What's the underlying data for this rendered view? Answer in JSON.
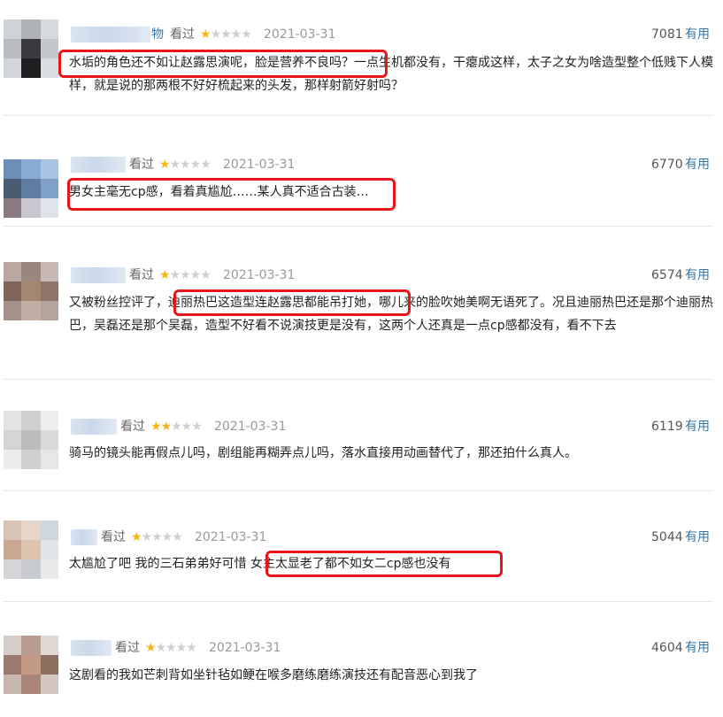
{
  "reviews": [
    {
      "name_suffix": "物",
      "seen": "看过",
      "rating": 1,
      "date": "2021-03-31",
      "votes": "7081",
      "useful": "有用",
      "content": "水垢的角色还不如让赵露思演呢，脸是营养不良吗？一点生机都没有，干瘪成这样，太子之女为啥造型整个低贱下人模样，就是说的那两根不好好梳起来的头发，那样射箭好射吗？"
    },
    {
      "name_suffix": "",
      "seen": "看过",
      "rating": 1,
      "date": "2021-03-31",
      "votes": "6770",
      "useful": "有用",
      "content": "男女主毫无cp感，看着真尴尬……某人真不适合古装…"
    },
    {
      "name_suffix": "",
      "seen": "看过",
      "rating": 1,
      "date": "2021-03-31",
      "votes": "6574",
      "useful": "有用",
      "content": "又被粉丝控评了，迪丽热巴这造型连赵露思都能吊打她，哪儿来的脸吹她美啊无语死了。况且迪丽热巴还是那个迪丽热巴，吴磊还是那个吴磊，造型不好看不说演技更是没有，这两个人还真是一点cp感都没有，看不下去"
    },
    {
      "name_suffix": "",
      "seen": "看过",
      "rating": 2,
      "date": "2021-03-31",
      "votes": "6119",
      "useful": "有用",
      "content": "骑马的镜头能再假点儿吗，剧组能再糊弄点儿吗，落水直接用动画替代了，那还拍什么真人。"
    },
    {
      "name_suffix": "",
      "seen": "看过",
      "rating": 1,
      "date": "2021-03-31",
      "votes": "5044",
      "useful": "有用",
      "content": "太尴尬了吧 我的三石弟弟好可惜 女主太显老了都不如女二cp感也没有"
    },
    {
      "name_suffix": "",
      "seen": "看过",
      "rating": 1,
      "date": "2021-03-31",
      "votes": "4604",
      "useful": "有用",
      "content": "这剧看的我如芒刺背如坐针毡如鲠在喉多磨练磨练演技还有配音恶心到我了"
    }
  ],
  "colors": {
    "link": "#3377aa",
    "star_on": "#f4b41a",
    "star_off": "#cfcfcf",
    "highlight": "#e8161b"
  }
}
